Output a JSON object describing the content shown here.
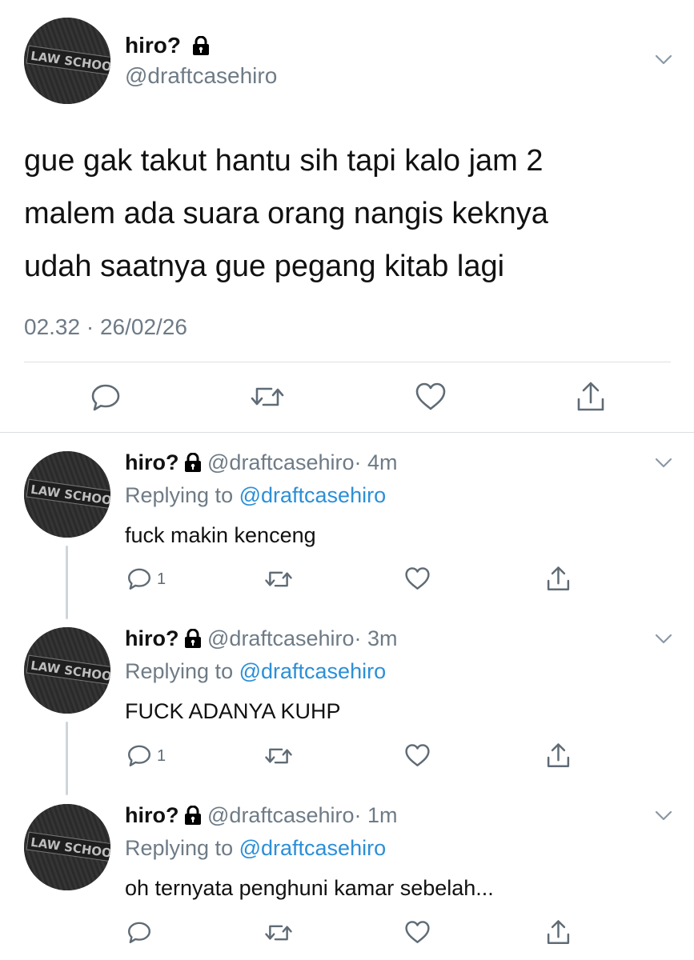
{
  "main_tweet": {
    "name": "hiro?",
    "handle": "@draftcasehiro",
    "text_lines": [
      "gue gak takut hantu sih tapi kalo jam 2",
      "malem ada suara orang nangis keknya",
      "udah saatnya gue pegang kitab lagi"
    ],
    "timestamp": "02.32 · 26/02/26",
    "avatar_text": "LAW SCHOOL"
  },
  "replies": [
    {
      "name": "hiro?",
      "handle": "@draftcasehiro",
      "time": "· 4m",
      "replying_prefix": "Replying to",
      "replying_to": "@draftcasehiro",
      "text": "fuck makin kenceng",
      "reply_count": "1"
    },
    {
      "name": "hiro?",
      "handle": "@draftcasehiro",
      "time": "· 3m",
      "replying_prefix": "Replying to",
      "replying_to": "@draftcasehiro",
      "text": "FUCK ADANYA KUHP",
      "reply_count": "1"
    },
    {
      "name": "hiro?",
      "handle": "@draftcasehiro",
      "time": "· 1m",
      "replying_prefix": "Replying to",
      "replying_to": "@draftcasehiro",
      "text": "oh ternyata penghuni kamar sebelah...",
      "reply_count": ""
    }
  ],
  "icons": {
    "reply": "reply-icon",
    "retweet": "retweet-icon",
    "like": "like-icon",
    "share": "share-icon",
    "chevron": "chevron-down-icon",
    "lock": "lock-icon"
  },
  "colors": {
    "link": "#2b8fd8",
    "muted": "#6e7b86",
    "divider": "#dcdfe2",
    "thread_line": "#cfd5da"
  }
}
